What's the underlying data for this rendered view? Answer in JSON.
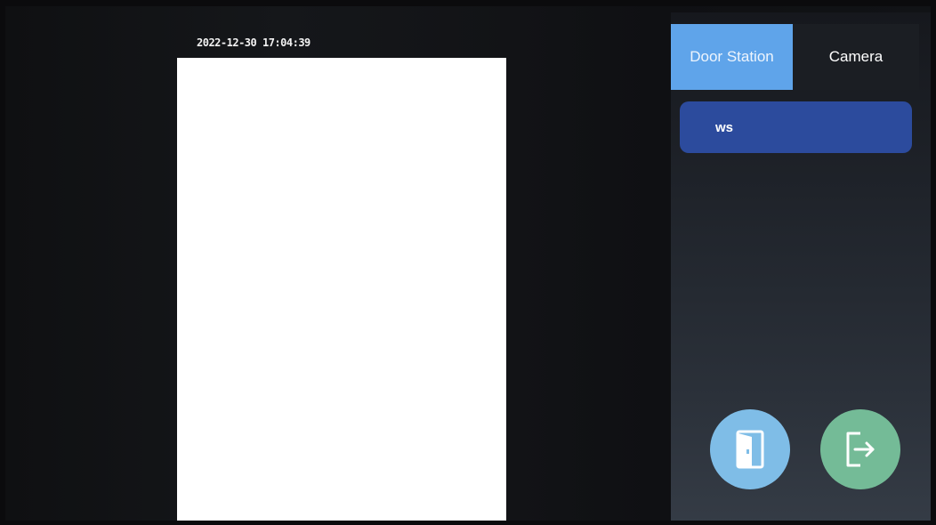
{
  "video": {
    "timestamp": "2022-12-30 17:04:39"
  },
  "tabs": [
    {
      "label": "Door Station",
      "active": true
    },
    {
      "label": "Camera",
      "active": false
    }
  ],
  "devices": [
    {
      "label": "ws",
      "selected": true
    }
  ],
  "actions": {
    "unlock_icon": "door-icon",
    "exit_icon": "exit-icon"
  },
  "colors": {
    "active_tab": "#5fa4ea",
    "selected_item": "#2c4b9d",
    "unlock_button": "#7fbde7",
    "exit_button": "#74bb97"
  }
}
